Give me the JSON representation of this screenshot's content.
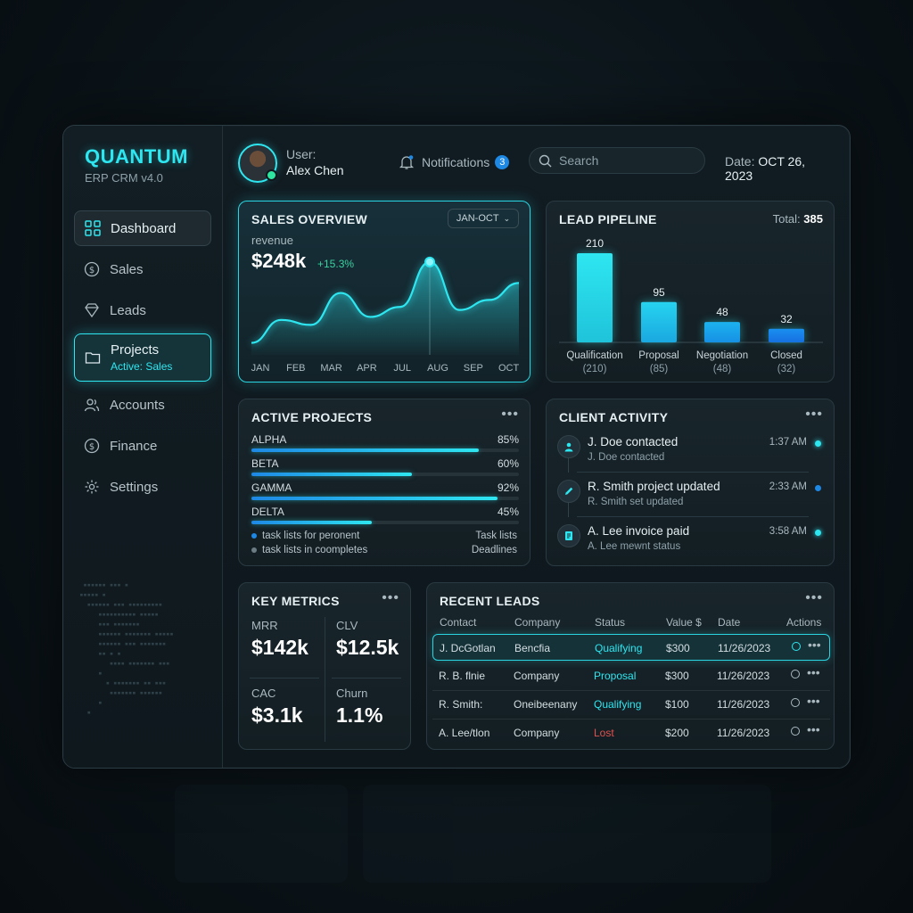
{
  "brand": {
    "name": "QUANTUM",
    "subtitle": "ERP CRM v4.0"
  },
  "nav": {
    "dashboard": "Dashboard",
    "sales": "Sales",
    "leads": "Leads",
    "projects": "Projects",
    "projects_sub": "Active: Sales",
    "accounts": "Accounts",
    "finance": "Finance",
    "settings": "Settings"
  },
  "topbar": {
    "user_label": "User:",
    "user_name": "Alex Chen",
    "notifications_label": "Notifications",
    "notifications_count": "3",
    "search_placeholder": "Search",
    "date_label": "Date:",
    "date_value": "OCT 26, 2023"
  },
  "sales_overview": {
    "title": "SALES OVERVIEW",
    "range": "JAN-OCT",
    "metric_label": "revenue",
    "metric_value": "$248k",
    "metric_change": "+15.3%",
    "months": [
      "JAN",
      "FEB",
      "MAR",
      "APR",
      "JUL",
      "AUG",
      "SEP",
      "OCT"
    ],
    "trend": [
      0.12,
      0.35,
      0.3,
      0.62,
      0.38,
      0.48,
      0.93,
      0.45,
      0.55,
      0.72
    ],
    "peak_index": 6
  },
  "lead_pipeline": {
    "title": "LEAD PIPELINE",
    "total_label": "Total:",
    "total_value": "385",
    "stages": [
      {
        "name": "Qualification",
        "count": 210,
        "label": "210",
        "sub": "(210)"
      },
      {
        "name": "Proposal",
        "count": 95,
        "label": "95",
        "sub": "(85)"
      },
      {
        "name": "Negotiation",
        "count": 48,
        "label": "48",
        "sub": "(48)"
      },
      {
        "name": "Closed",
        "count": 32,
        "label": "32",
        "sub": "(32)"
      }
    ]
  },
  "active_projects": {
    "title": "ACTIVE PROJECTS",
    "items": [
      {
        "name": "ALPHA",
        "pct_label": "85%",
        "pct": 0.85
      },
      {
        "name": "BETA",
        "pct_label": "60%",
        "pct": 0.6
      },
      {
        "name": "GAMMA",
        "pct_label": "92%",
        "pct": 0.92
      },
      {
        "name": "DELTA",
        "pct_label": "45%",
        "pct": 0.45
      }
    ],
    "legend": [
      {
        "text": "task lists for peronent",
        "right": "Task lists",
        "color": "#1e88e5"
      },
      {
        "text": "task lists in coompletes",
        "right": "Deadlines",
        "color": "#6b7c84"
      }
    ]
  },
  "client_activity": {
    "title": "CLIENT ACTIVITY",
    "items": [
      {
        "title": "J. Doe contacted",
        "sub": "J. Doe contacted",
        "time": "1:37 AM",
        "icon": "user-icon",
        "dot": "#2ee6f0"
      },
      {
        "title": "R. Smith project updated",
        "sub": "R. Smith set updated",
        "time": "2:33 AM",
        "icon": "pencil-icon",
        "dot": "#1e88e5"
      },
      {
        "title": "A. Lee invoice paid",
        "sub": "A. Lee mewnt status",
        "time": "3:58 AM",
        "icon": "invoice-icon",
        "dot": "#2ee6f0"
      }
    ]
  },
  "key_metrics": {
    "title": "KEY METRICS",
    "items": [
      {
        "label": "MRR",
        "value": "$142k"
      },
      {
        "label": "CLV",
        "value": "$12.5k"
      },
      {
        "label": "CAC",
        "value": "$3.1k"
      },
      {
        "label": "Churn",
        "value": "1.1%"
      }
    ]
  },
  "recent_leads": {
    "title": "RECENT LEADS",
    "columns": [
      "Contact",
      "Company",
      "Status",
      "Value $",
      "Date",
      "Actions"
    ],
    "rows": [
      {
        "contact": "J. DcGotlan",
        "company": "Bencfia",
        "status": "Qualifying",
        "value": "$300",
        "date": "11/26/2023",
        "status_color": "#2ee6f0"
      },
      {
        "contact": "R. B. flnie",
        "company": "Company",
        "status": "Proposal",
        "value": "$300",
        "date": "11/26/2023",
        "status_color": "#2ee6f0"
      },
      {
        "contact": "R. Smith:",
        "company": "Oneibeenany",
        "status": "Qualifying",
        "value": "$100",
        "date": "11/26/2023",
        "status_color": "#2ee6f0"
      },
      {
        "contact": "A. Lee/tlon",
        "company": "Company",
        "status": "Lost",
        "value": "$200",
        "date": "11/26/2023",
        "status_color": "#e0524f"
      }
    ]
  },
  "colors": {
    "accent": "#2ee6f0",
    "accent_blue": "#1e88e5",
    "success": "#3ad29f",
    "danger": "#e0524f"
  }
}
